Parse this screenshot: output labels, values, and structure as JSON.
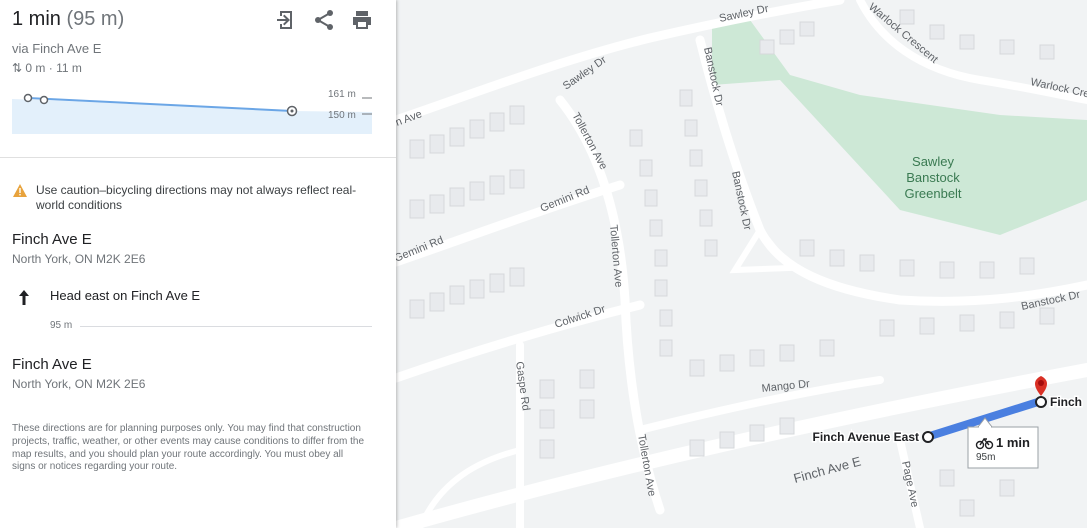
{
  "panel": {
    "duration": "1 min",
    "distance": "(95 m)",
    "via": "via Finch Ave E",
    "elevation": "0 m · 11 m",
    "elev_labels": [
      "161 m",
      "150 m"
    ],
    "warning": "Use caution–bicycling directions may not always reflect real-world conditions",
    "start": {
      "name": "Finch Ave E",
      "address": "North York, ON M2K 2E6"
    },
    "step": {
      "instruction": "Head east on Finch Ave E",
      "distance": "95 m"
    },
    "end": {
      "name": "Finch Ave E",
      "address": "North York, ON M2K 2E6"
    },
    "disclaimer": "These directions are for planning purposes only. You may find that construction projects, traffic, weather, or other events may cause conditions to differ from the map results, and you should plan your route accordingly. You must obey all signs or notices regarding your route.",
    "icons": [
      "open-in-new-icon",
      "share-icon",
      "print-icon",
      "warning-icon",
      "arrow-up-icon"
    ]
  },
  "map": {
    "streets": [
      "Sawley Dr",
      "Sawley Dr",
      "Warlock Crescent",
      "Warlock Cre",
      "Banstock Dr",
      "Banstock Dr",
      "Banstock Dr",
      "Tollerton Ave",
      "Tollerton Ave",
      "Tollerton Ave",
      "Gemini Rd",
      "Gemini Rd",
      "Colwick Dr",
      "Gaspe Rd",
      "Mango Dr",
      "Finch Ave E",
      "Page Ave",
      "n Ave"
    ],
    "park": "Sawley Banstock Greenbelt",
    "park_lines": [
      "Sawley",
      "Banstock",
      "Greenbelt"
    ],
    "start_label": "Finch Avenue East",
    "end_label": "Finch",
    "route_card": {
      "time": "1 min",
      "distance": "95m"
    },
    "colors": {
      "route": "#4a7fe0",
      "park": "#c8e6d0",
      "pin": "#d93025"
    }
  }
}
